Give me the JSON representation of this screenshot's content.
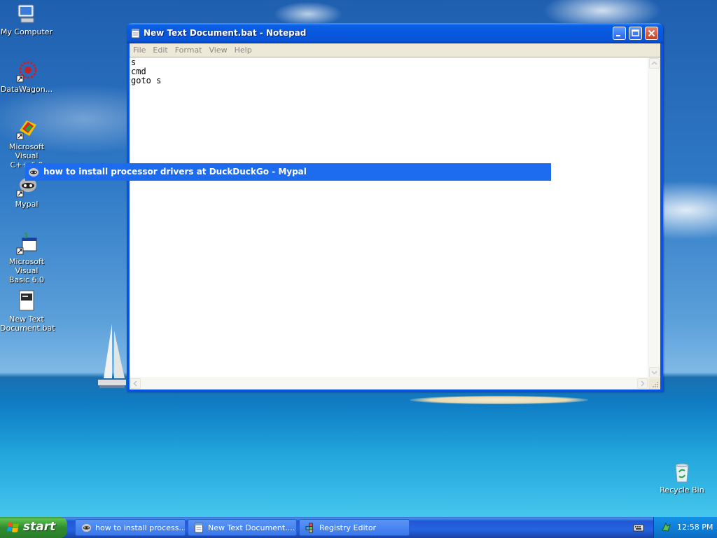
{
  "desktop": {
    "icons": [
      {
        "label": "My Computer"
      },
      {
        "label": "DataWagon..."
      },
      {
        "label": "Microsoft Visual\nC++ 6.0"
      },
      {
        "label": "Mypal"
      },
      {
        "label": "Microsoft Visual\nBasic 6.0"
      },
      {
        "label": "New Text\nDocument.bat"
      },
      {
        "label": "Recycle Bin"
      }
    ]
  },
  "notepad": {
    "title": "New Text Document.bat - Notepad",
    "menu": [
      "File",
      "Edit",
      "Format",
      "View",
      "Help"
    ],
    "content": "s\ncmd\ngoto s"
  },
  "tooltip": {
    "text": "how to install processor drivers at DuckDuckGo - Mypal"
  },
  "taskbar": {
    "start_label": "start",
    "tasks": [
      {
        "label": "how to install process..."
      },
      {
        "label": "New Text Document...."
      },
      {
        "label": "Registry Editor"
      }
    ],
    "clock": "12:58 PM"
  },
  "colors": {
    "titlebar": "#0a5fe6",
    "taskbar": "#2663e0",
    "start_button": "#3c9a3c",
    "tooltip_bg": "#1d6cf0"
  }
}
